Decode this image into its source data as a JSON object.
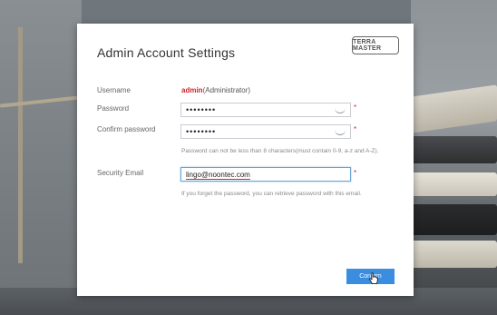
{
  "dialog": {
    "title": "Admin Account Settings",
    "logo_text": "TERRA MASTER",
    "username": {
      "label": "Username",
      "name": "admin",
      "role": "(Administrator)"
    },
    "password": {
      "label": "Password",
      "value": "••••••••",
      "required": "*"
    },
    "confirm_password": {
      "label": "Confirm password",
      "value": "••••••••",
      "required": "*"
    },
    "password_hint": "Password can not be less than 8 characters(must contain 0-9, a-z and A-Z).",
    "security_email": {
      "label": "Security Email",
      "value": "lingo@noontec.com",
      "required": "*"
    },
    "email_hint": "If you forget the password, you can retrieve password with this email.",
    "confirm_label": "Confirm"
  },
  "colors": {
    "accent": "#3b8de0",
    "required": "#d0232a",
    "username": "#d0232a"
  },
  "icons": [
    "eye-closed-icon",
    "hand-cursor-icon"
  ]
}
